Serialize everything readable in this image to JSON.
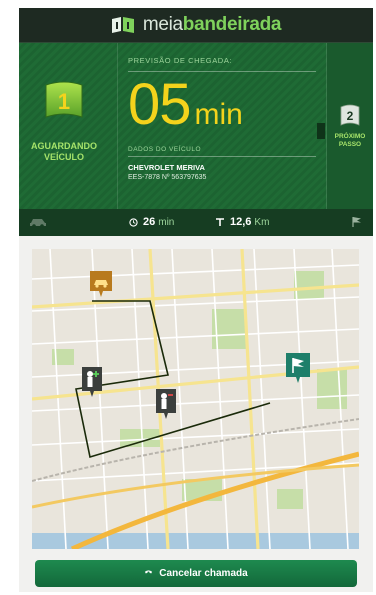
{
  "app": {
    "brand_light": "meia",
    "brand_bold": "bandeirada"
  },
  "status": {
    "current_step": "1",
    "current_label_line1": "AGUARDANDO",
    "current_label_line2": "VEÍCULO",
    "next_step": "2",
    "next_label_line1": "PRÓXIMO",
    "next_label_line2": "PASSO"
  },
  "arrival": {
    "label": "PREVISÃO DE CHEGADA:",
    "value": "05",
    "unit": "min"
  },
  "vehicle": {
    "label": "DADOS DO VEÍCULO",
    "model": "CHEVROLET MERIVA",
    "plate": "EES-7878 Nº 563797635"
  },
  "trip": {
    "time_value": "26",
    "time_unit": "min",
    "distance_value": "12,6",
    "distance_unit": "Km"
  },
  "actions": {
    "cancel_label": "Cancelar chamada"
  },
  "colors": {
    "accent_green": "#7fd25c",
    "eta_yellow": "#f4d31c",
    "panel_green": "#1f6b35",
    "button_green": "#17784a"
  },
  "icons": [
    "logo-flags-icon",
    "flag-step1-icon",
    "flag-step2-icon",
    "car-icon",
    "clock-icon",
    "road-icon",
    "finish-flag-icon",
    "taxi-marker-icon",
    "person-marker-icon",
    "destination-marker-icon",
    "phone-icon"
  ]
}
